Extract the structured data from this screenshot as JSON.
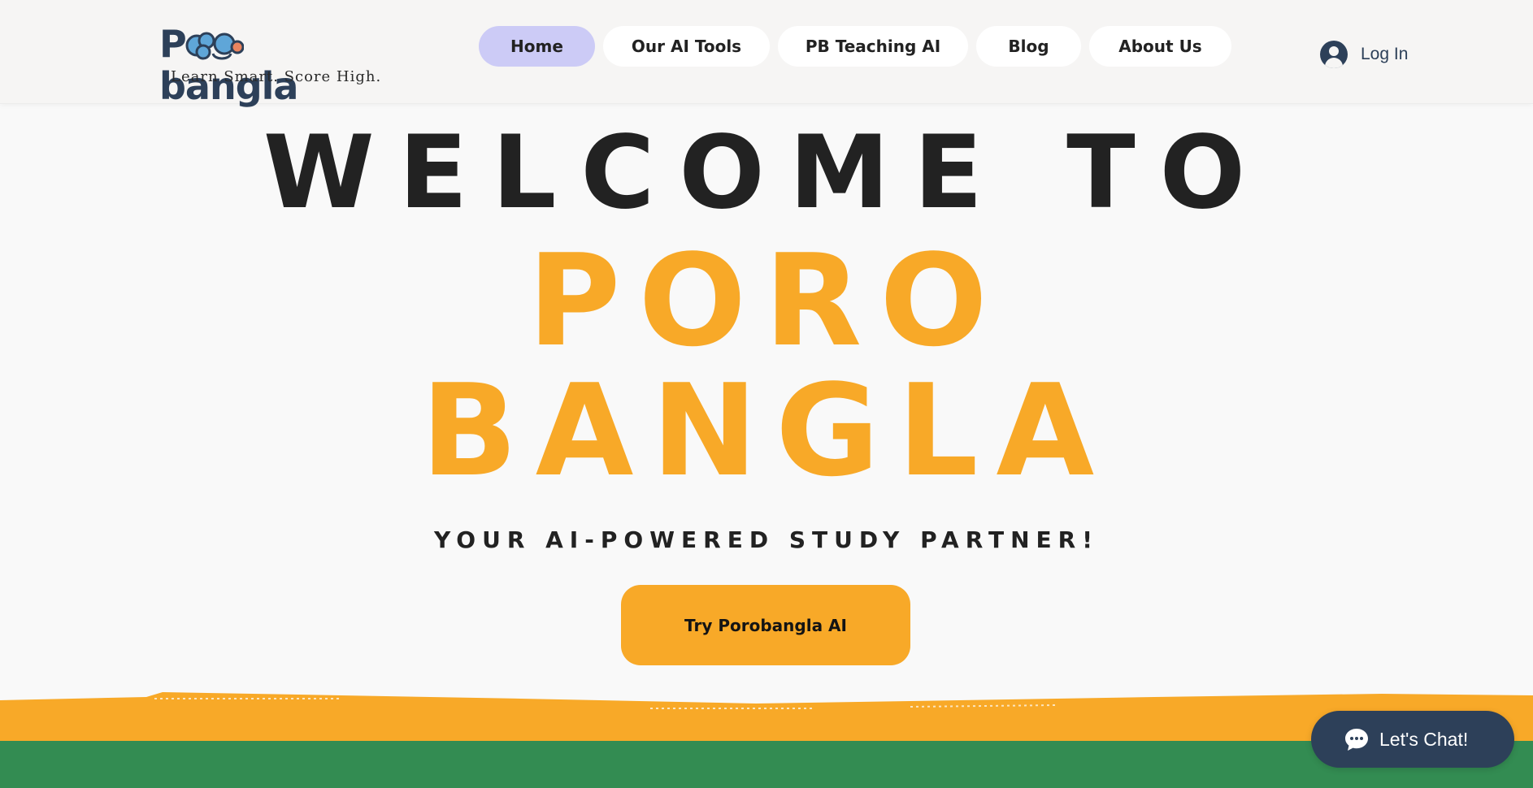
{
  "header": {
    "logo": {
      "wordmark_start": "P",
      "wordmark_end": "bangla",
      "tagline": "Learn Smart. Score High."
    },
    "nav": [
      {
        "label": "Home",
        "active": true
      },
      {
        "label": "Our AI Tools",
        "active": false
      },
      {
        "label": "PB Teaching AI",
        "active": false
      },
      {
        "label": "Blog",
        "active": false
      },
      {
        "label": "About Us",
        "active": false
      }
    ],
    "login_label": "Log In"
  },
  "hero": {
    "welcome": "WELCOME TO",
    "brand_line1": "PORO",
    "brand_line2": "BANGLA",
    "subtitle": "YOUR AI-POWERED STUDY PARTNER!",
    "cta_label": "Try Porobangla AI"
  },
  "chat_widget": {
    "label": "Let's Chat!",
    "icon": "chat-bubble-icon"
  },
  "colors": {
    "accent": "#f8a928",
    "active_nav": "#cccbf6",
    "brand_navy": "#2d4059",
    "green_band": "#338c52",
    "text_dark": "#222222"
  }
}
